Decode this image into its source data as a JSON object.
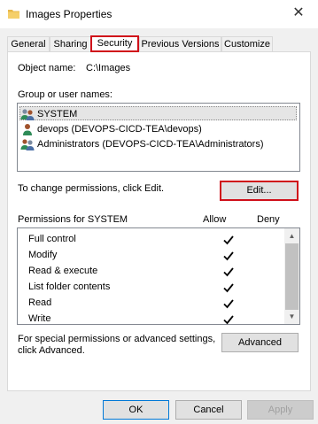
{
  "window": {
    "title": "Images Properties",
    "close_glyph": "✕"
  },
  "tabs": [
    "General",
    "Sharing",
    "Security",
    "Previous Versions",
    "Customize"
  ],
  "object": {
    "label": "Object name:",
    "value": "C:\\Images"
  },
  "groups": {
    "label": "Group or user names:",
    "items": [
      {
        "name": "SYSTEM",
        "icon": "users-group-icon"
      },
      {
        "name": "devops (DEVOPS-CICD-TEA\\devops)",
        "icon": "user-icon"
      },
      {
        "name": "Administrators (DEVOPS-CICD-TEA\\Administrators)",
        "icon": "users-group-icon"
      }
    ]
  },
  "change_text": "To change permissions, click Edit.",
  "edit_label": "Edit...",
  "permissions": {
    "header": "Permissions for SYSTEM",
    "allow": "Allow",
    "deny": "Deny",
    "rows": [
      {
        "name": "Full control",
        "allow": true,
        "deny": false
      },
      {
        "name": "Modify",
        "allow": true,
        "deny": false
      },
      {
        "name": "Read & execute",
        "allow": true,
        "deny": false
      },
      {
        "name": "List folder contents",
        "allow": true,
        "deny": false
      },
      {
        "name": "Read",
        "allow": true,
        "deny": false
      },
      {
        "name": "Write",
        "allow": true,
        "deny": false
      }
    ]
  },
  "special_text_1": "For special permissions or advanced settings,",
  "special_text_2": "click Advanced.",
  "advanced_label": "Advanced",
  "footer": {
    "ok": "OK",
    "cancel": "Cancel",
    "apply": "Apply"
  },
  "colors": {
    "highlight": "#d0101a",
    "window_bg": "#f0f0f0"
  }
}
